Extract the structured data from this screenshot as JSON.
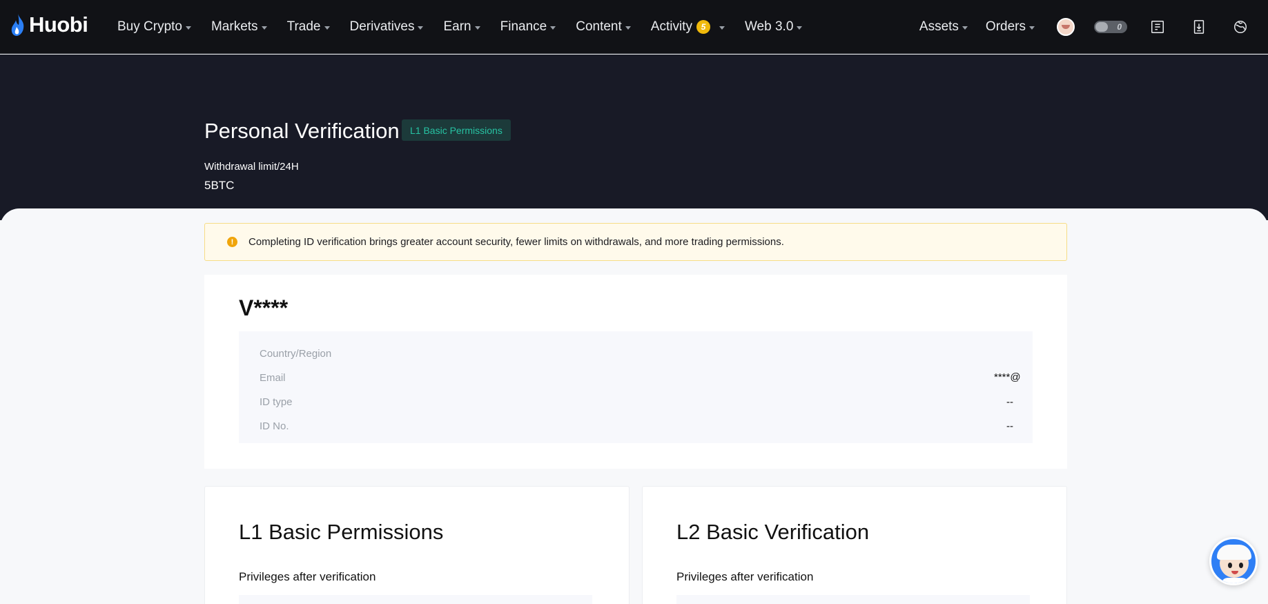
{
  "nav": {
    "logo_text": "Huobi",
    "items": [
      {
        "label": "Buy Crypto"
      },
      {
        "label": "Markets"
      },
      {
        "label": "Trade"
      },
      {
        "label": "Derivatives"
      },
      {
        "label": "Earn"
      },
      {
        "label": "Finance"
      },
      {
        "label": "Content"
      },
      {
        "label": "Activity",
        "badge": "5"
      },
      {
        "label": "Web 3.0"
      }
    ],
    "right": {
      "assets": "Assets",
      "orders": "Orders",
      "toggle_value": "0"
    },
    "icons": [
      "avatar-icon",
      "notes-icon",
      "download-icon",
      "language-icon"
    ]
  },
  "hero": {
    "title": "Personal Verification",
    "level_badge": "L1 Basic Permissions",
    "limit_label": "Withdrawal limit/24H",
    "limit_value": "5BTC"
  },
  "notice": {
    "icon": "!",
    "text": "Completing ID verification brings greater account security, fewer limits on withdrawals, and more trading permissions."
  },
  "identity": {
    "username": "V****",
    "rows": [
      {
        "label": "Country/Region",
        "value": ""
      },
      {
        "label": "Email",
        "value": "****@"
      },
      {
        "label": "ID type",
        "value": "--"
      },
      {
        "label": "ID No.",
        "value": "--"
      }
    ]
  },
  "levels": [
    {
      "title": "L1 Basic Permissions",
      "subtitle": "Privileges after verification"
    },
    {
      "title": "L2 Basic Verification",
      "subtitle": "Privileges after verification"
    }
  ],
  "colors": {
    "nav_bg": "#111216",
    "hero_bg": "#181a26",
    "accent_green": "#27c3a3",
    "warning": "#f0a50b",
    "activity_badge": "#f0b90b"
  }
}
